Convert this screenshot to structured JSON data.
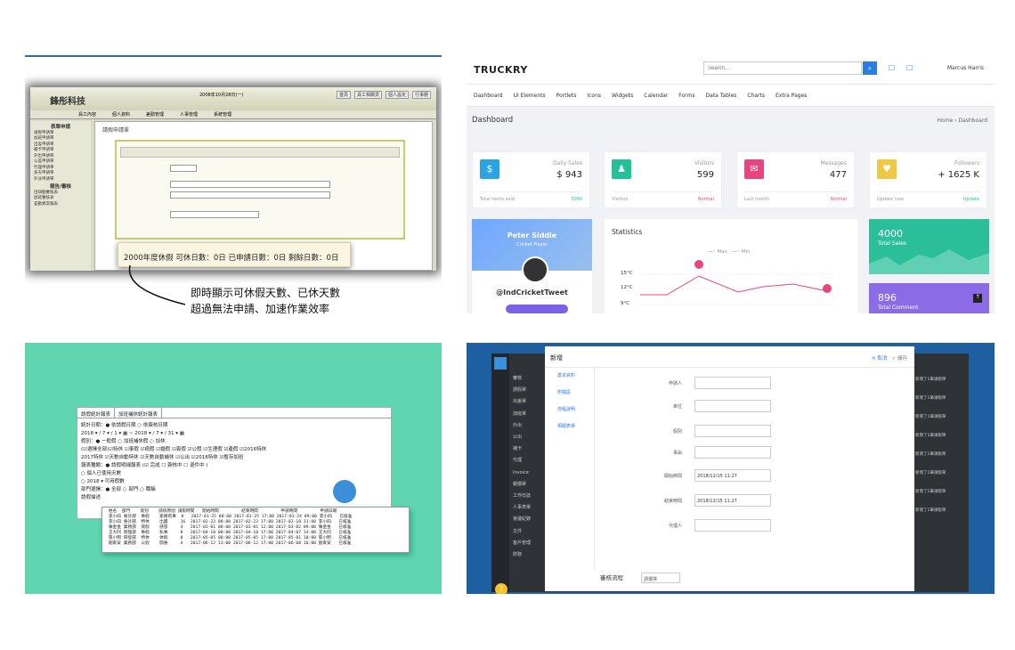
{
  "p1": {
    "brand": "鋒彤科技",
    "header_links": [
      "首頁",
      "員工相關頁",
      "個人設定",
      "行事曆"
    ],
    "header_date": "2008年10月28日(一)",
    "menu": [
      "員工內容",
      "個人資料",
      "差勤管理",
      "人事管理",
      "系統管理"
    ],
    "side_title": "表單申請",
    "side_items": [
      "請假申請單",
      "加班申請單",
      "出差申請單",
      "補卡申請單",
      "外出申請單",
      "公差申請單",
      "代理申請單",
      "多天申請單",
      "外派申請單"
    ],
    "side_title2": "報告/審核",
    "side_items2": [
      "出缺勤審核表",
      "加班審核表",
      "差勤異常報表"
    ],
    "form_tab": "請假申請單",
    "tip": "2000年度休假  可休日數：0日  已申請日數：0日  剩餘日數：0日",
    "note_line1": "即時顯示可休假天數、已休天數",
    "note_line2": "超過無法申請、加速作業效率"
  },
  "p2": {
    "logo": "TRUCKRY",
    "search_placeholder": "Search...",
    "user": "Marcus Harris",
    "nav": [
      "Dashboard",
      "UI Elements",
      "Portlets",
      "Icons",
      "Widgets",
      "Calendar",
      "Forms",
      "Data Tables",
      "Charts",
      "Extra Pages"
    ],
    "page_title": "Dashboard",
    "crumb": "Home › Dashboard",
    "cards": [
      {
        "label": "Daily Sales",
        "value": "$ 943",
        "foot_left": "Total items sold",
        "foot_right": "3000",
        "color": "#2ba4e3",
        "icon": "$"
      },
      {
        "label": "Visitors",
        "value": "599",
        "foot_left": "Visitors",
        "foot_right": "Normal",
        "color": "#21c29a",
        "icon": "♟"
      },
      {
        "label": "Messages",
        "value": "477",
        "foot_left": "Last month",
        "foot_right": "Normal",
        "color": "#e8457f",
        "icon": "✉"
      },
      {
        "label": "Followers",
        "value": "+ 1625 K",
        "foot_left": "Update now",
        "foot_right": "Update",
        "color": "#f0c742",
        "icon": "♥"
      }
    ],
    "profile_name": "Peter Siddle",
    "profile_sub": "Cricket Player",
    "profile_handle": "@IndCricketTweet",
    "stats_title": "Statistics",
    "legend_max": "Max",
    "legend_min": "Min",
    "y_ticks": [
      "15°C",
      "12°C",
      "9°C"
    ],
    "tile1_value": "4000",
    "tile1_label": "Total Sales",
    "tile2_value": "896",
    "tile2_label": "Total Comment"
  },
  "p3": {
    "tabs": [
      "請假統計報表",
      "加班補休統計報表"
    ],
    "row1": "統計日期：● 依請假日期  ○ 依簽核日期",
    "row1b": "2018 ▾ / 7 ▾ / 1 ▾ ▦ ~ 2018 ▾ / 7 ▾ / 31 ▾ ▦",
    "row2": "假別：● 一般假  ○ 加班補休假  ○ 加休",
    "row2b": "(☑選擇全部)☑特休 ☑事假 ☑病假 ☑婚假 ☑喪假 ☑公假 ☑生理假 ☑產假 ☑2016特休",
    "row2c": "2017特休 ☑天數自動特休 ☑天數自動補休 ☑公出 ☑2018特休 ☑暫存加班",
    "row3": "報表種類：● 請假明細報表 (☑ 完成  ☐ 簽核中  ☐ 退件中 )",
    "row3b": "○ 個人已使用天數",
    "row3c": "○ 2018 ▾ 可用假數",
    "row4": "部門選擇：● 全部  ○ 部門  ○ 職稱",
    "row5": "請假描述",
    "table": " 姓名  部門    假別    請假原因 請假時間   開始時間         結束時間         申請時間         申請日期  \n 李小四 會計部  事假    家裡有事  8   2017-01-25 08:00 2017-01-25 17:00 2017-01-24 09:00 李小四   已核准\n 李小四 會計部  特休    出國     16  2017-02-22 08:00 2017-02-23 17:00 2017-02-10 11:00 李小四   已核准\n 陳金金 業務部  病假    感冒     4   2017-03-01 08:00 2017-03-01 12:00 2017-03-02 09:00 陳金金   已核准\n 王大同 管理部  事假    私事     8   2017-04-10 08:00 2017-04-10 17:00 2017-04-07 14:00 王大同   已核准\n 張小明 研發部  特休    休假     8   2017-05-05 08:00 2017-05-05 17:00 2017-05-01 10:00 張小明   已核准\n 劉家安 業務部  公假    開會     4   2017-06-12 13:00 2017-06-12 17:00 2017-06-08 16:00 劉家安   已核准"
  },
  "p4": {
    "title": "新增",
    "act_cancel": "✕ 取消",
    "act_save": "✓ 儲存",
    "leftnav": [
      "基本資料",
      "附檔區",
      "流程說明",
      "相關表單"
    ],
    "menu": [
      "審核",
      "請假單",
      "出差單",
      "加班單",
      "外出",
      "公出",
      "補卡",
      "代理",
      "Invoice",
      "報價單",
      "工作日誌",
      "人事表單",
      "會議紀錄",
      "文件",
      "客戶管理",
      "財務"
    ],
    "fields": [
      {
        "label": "申請人",
        "value": ""
      },
      {
        "label": "單位",
        "value": ""
      },
      {
        "label": "假別",
        "value": ""
      },
      {
        "label": "事由",
        "value": ""
      },
      {
        "label": "開始時間",
        "value": "2018/12/15 11:27"
      },
      {
        "label": "結束時間",
        "value": "2018/12/15 11:27"
      },
      {
        "label": "代理人",
        "value": ""
      }
    ],
    "flow_label": "審核流程",
    "flow_select": "請選擇",
    "right_items": [
      "新增了1筆請假單",
      "新增了1筆請假單",
      "新增了1筆請假單",
      "新增了1筆請假單",
      "新增了1筆請假單",
      "新增了1筆請假單",
      "新增了1筆請假單",
      "新增了1筆請假單"
    ]
  }
}
